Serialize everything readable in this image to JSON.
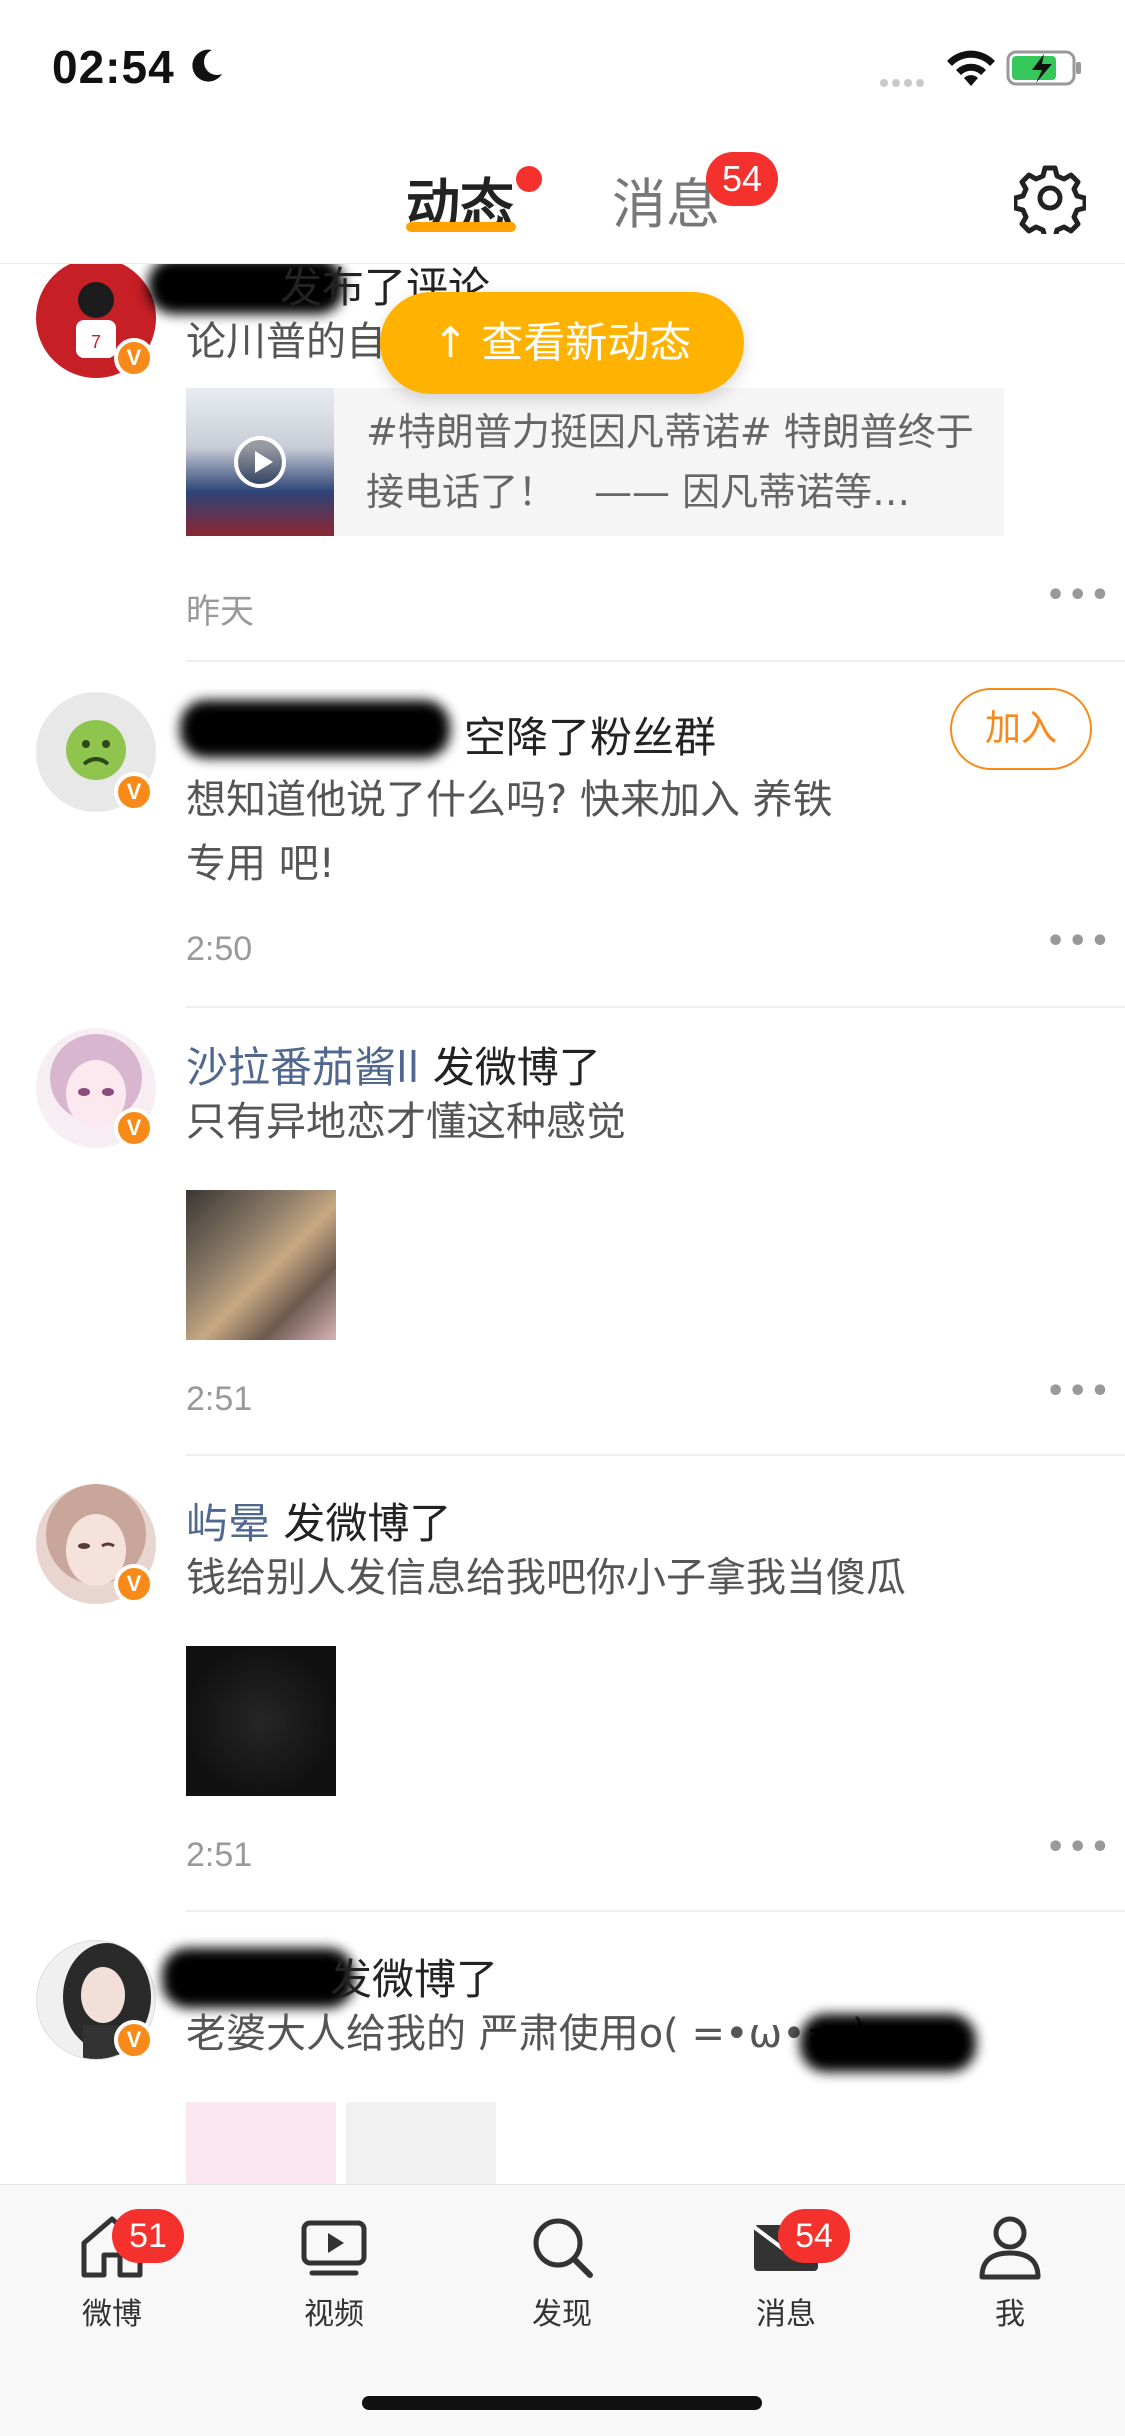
{
  "status_bar": {
    "time": "02:54"
  },
  "header": {
    "tabs": [
      {
        "label": "动态",
        "active": true
      },
      {
        "label": "消息",
        "badge": "54"
      }
    ]
  },
  "new_updates_button": "↑ 查看新动态",
  "feed": [
    {
      "action": "发布了评论",
      "text": "论川普的自",
      "card_text": "#特朗普力挺因凡蒂诺# 特朗普终于接电话了！　—— 因凡蒂诺等…",
      "time": "昨天"
    },
    {
      "action": "空降了粉丝群",
      "text": "想知道他说了什么吗? 快来加入 养铁专用 吧!",
      "button": "加入",
      "time": "2:50"
    },
    {
      "username": "沙拉番茄酱ll",
      "action": "发微博了",
      "text": "只有异地恋才懂这种感觉",
      "time": "2:51"
    },
    {
      "username": "屿晕",
      "action": "发微博了",
      "text": "钱给别人发信息给我吧你小子拿我当傻瓜",
      "time": "2:51"
    },
    {
      "action": "发微博了",
      "text": "老婆大人给我的 严肃使用o( =•ω•= )"
    }
  ],
  "bottom_nav": [
    {
      "label": "微博",
      "icon": "home-icon",
      "badge": "51"
    },
    {
      "label": "视频",
      "icon": "video-icon"
    },
    {
      "label": "发现",
      "icon": "search-icon"
    },
    {
      "label": "消息",
      "icon": "mail-icon",
      "badge": "54"
    },
    {
      "label": "我",
      "icon": "profile-icon"
    }
  ],
  "colors": {
    "accent": "#ffa200",
    "badge": "#f4312d",
    "verified": "#f88a19",
    "username": "#506790"
  }
}
